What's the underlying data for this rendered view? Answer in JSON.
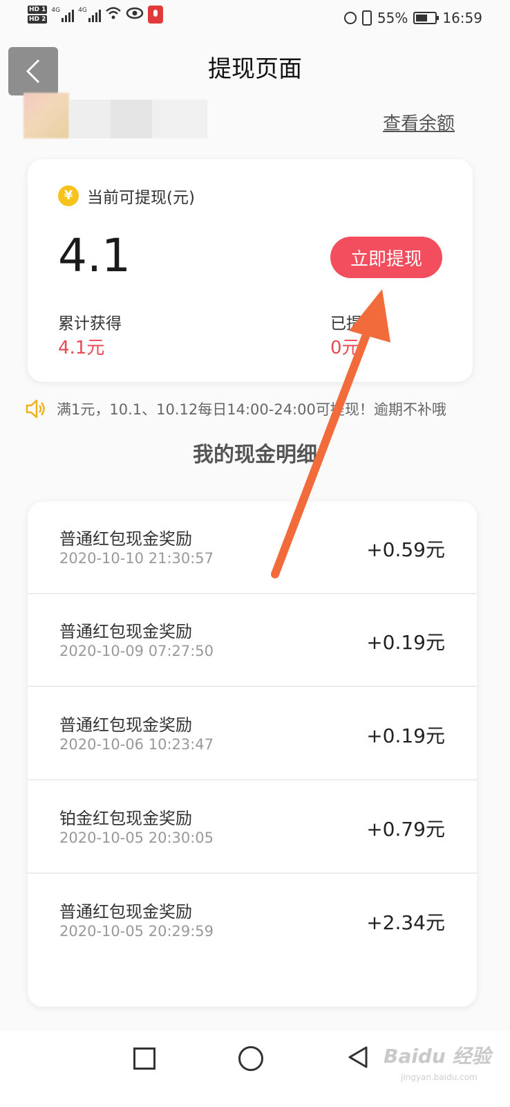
{
  "status_bar": {
    "hd1": "HD 1",
    "hd2": "HD 2",
    "net1": "4G",
    "net2": "4G",
    "battery": "55%",
    "time": "16:59"
  },
  "header": {
    "title": "提现页面",
    "balance_link": "查看余额"
  },
  "card": {
    "label": "当前可提现(元)",
    "amount": "4.1",
    "withdraw_button": "立即提现",
    "cumulative_label": "累计获得",
    "cumulative_value": "4.1元",
    "withdrawn_label": "已提现",
    "withdrawn_value": "0元",
    "coin_symbol": "¥"
  },
  "notice": "满1元，10.1、10.12每日14:00-24:00可提现！逾期不补哦",
  "section_title": "我的现金明细",
  "transactions": [
    {
      "title": "普通红包现金奖励",
      "time": "2020-10-10 21:30:57",
      "amount": "+0.59元"
    },
    {
      "title": "普通红包现金奖励",
      "time": "2020-10-09 07:27:50",
      "amount": "+0.19元"
    },
    {
      "title": "普通红包现金奖励",
      "time": "2020-10-06 10:23:47",
      "amount": "+0.19元"
    },
    {
      "title": "铂金红包现金奖励",
      "time": "2020-10-05 20:30:05",
      "amount": "+0.79元"
    },
    {
      "title": "普通红包现金奖励",
      "time": "2020-10-05 20:29:59",
      "amount": "+2.34元"
    }
  ],
  "watermark": {
    "main": "Baidu 经验",
    "sub": "jingyan.baidu.com"
  },
  "colors": {
    "accent": "#f24e5d",
    "value_red": "#e94a52",
    "arrow": "#f26b3a",
    "coin": "#f6c21b"
  }
}
